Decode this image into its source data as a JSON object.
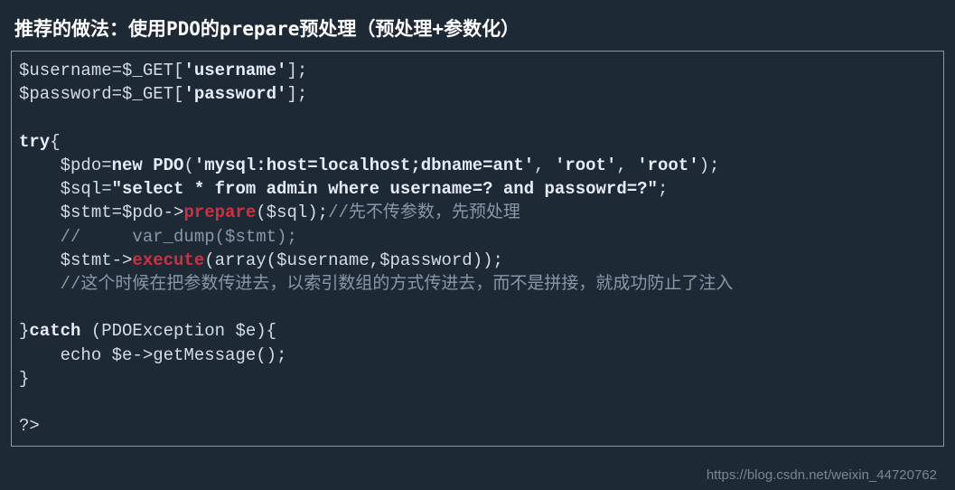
{
  "title": "推荐的做法：使用PDO的prepare预处理（预处理+参数化）",
  "code": {
    "l1a": "$username=$_GET[",
    "l1b": "'username'",
    "l1c": "];",
    "l2a": "$password=$_GET[",
    "l2b": "'password'",
    "l2c": "];",
    "l3": "",
    "l4a": "try",
    "l4b": "{",
    "l5a": "    $pdo=",
    "l5b": "new",
    "l5c": " ",
    "l5d": "PDO",
    "l5e": "(",
    "l5f": "'mysql:host=localhost;dbname=ant'",
    "l5g": ", ",
    "l5h": "'root'",
    "l5i": ", ",
    "l5j": "'root'",
    "l5k": ");",
    "l6a": "    $sql=",
    "l6b": "\"select * from admin where username=? and passowrd=?\"",
    "l6c": ";",
    "l7a": "    $stmt=$pdo->",
    "l7b": "prepare",
    "l7c": "($sql);",
    "l7d": "//先不传参数，先预处理",
    "l8a": "    ",
    "l8b": "//     var_dump($stmt);",
    "l9a": "    $stmt->",
    "l9b": "execute",
    "l9c": "(array($username,$password));",
    "l10a": "    ",
    "l10b": "//这个时候在把参数传进去，以索引数组的方式传进去，而不是拼接，就成功防止了注入",
    "l11": "",
    "l12a": "}",
    "l12b": "catch",
    "l12c": " (PDOException $e){",
    "l13": "    echo $e->getMessage();",
    "l14": "}",
    "l15": "",
    "l16": "?>"
  },
  "watermark": "https://blog.csdn.net/weixin_44720762"
}
